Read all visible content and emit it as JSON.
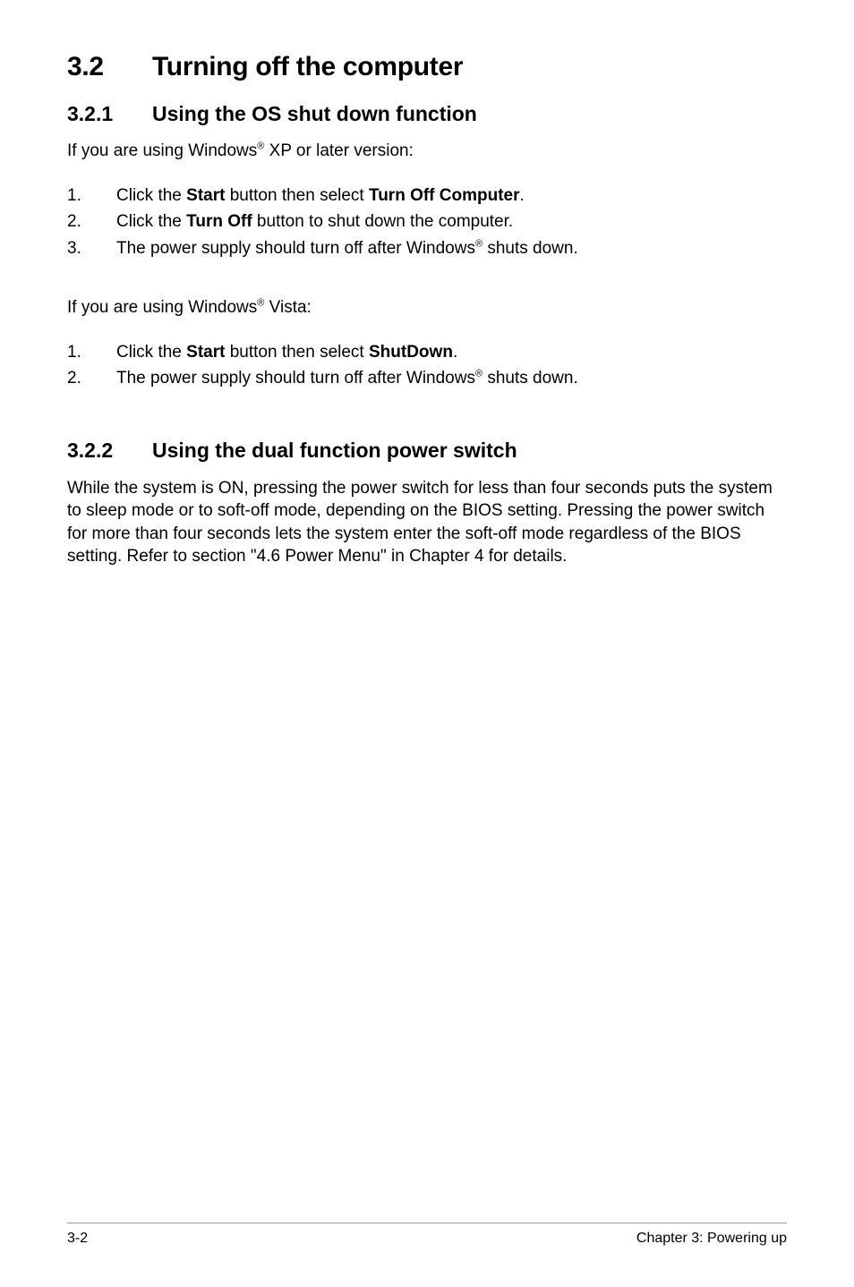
{
  "section": {
    "number": "3.2",
    "title": "Turning off the computer"
  },
  "sub1": {
    "number": "3.2.1",
    "title": "Using the OS shut down function",
    "intro_prefix": "If you are using Windows",
    "intro_suffix": " XP or later version:",
    "steps": [
      {
        "num": "1.",
        "text_prefix": "Click the ",
        "bold1": "Start",
        "mid": " button then select ",
        "bold2": "Turn Off Computer",
        "suffix": "."
      },
      {
        "num": "2.",
        "text_prefix": "Click the ",
        "bold1": "Turn Off",
        "mid": " button to shut down the computer.",
        "bold2": "",
        "suffix": ""
      },
      {
        "num": "3.",
        "text_prefix": "The power supply should turn off after Windows",
        "sup": "®",
        "suffix": " shuts down."
      }
    ],
    "intro2_prefix": "If you are using Windows",
    "intro2_suffix": " Vista:",
    "steps2": [
      {
        "num": "1.",
        "text_prefix": "Click the ",
        "bold1": "Start",
        "mid": " button then select ",
        "bold2": "ShutDown",
        "suffix": "."
      },
      {
        "num": "2.",
        "text_prefix": "The power supply should turn off after Windows",
        "sup": "®",
        "suffix": " shuts down."
      }
    ]
  },
  "sub2": {
    "number": "3.2.2",
    "title": "Using the dual function power switch",
    "body": "While the system is ON, pressing the power switch for less than four seconds puts the system to sleep mode or to soft-off mode, depending on the BIOS setting. Pressing the power switch for more than four seconds lets the system enter the soft-off mode regardless of the BIOS setting. Refer to section \"4.6 Power Menu\" in Chapter 4 for details."
  },
  "footer": {
    "left": "3-2",
    "right": "Chapter 3: Powering up"
  },
  "reg": "®"
}
